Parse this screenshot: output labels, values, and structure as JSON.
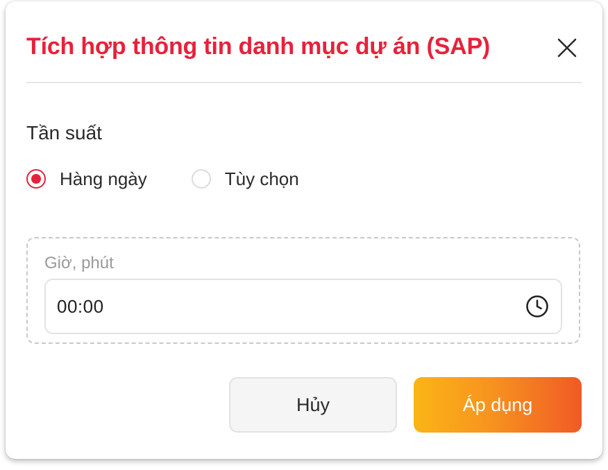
{
  "dialog": {
    "title": "Tích hợp thông tin danh mục dự án (SAP)",
    "close_icon": "close-icon",
    "frequency": {
      "label": "Tần suất",
      "options": [
        {
          "label": "Hàng ngày",
          "selected": true
        },
        {
          "label": "Tùy chọn",
          "selected": false
        }
      ]
    },
    "time": {
      "label": "Giờ, phút",
      "value": "00:00",
      "icon": "clock-icon"
    },
    "buttons": {
      "cancel_label": "Hủy",
      "apply_label": "Áp dụng"
    }
  },
  "colors": {
    "title": "#e8213a",
    "radio_selected": "#e8213a",
    "apply_gradient_start": "#fbb516",
    "apply_gradient_end": "#f05a25"
  }
}
